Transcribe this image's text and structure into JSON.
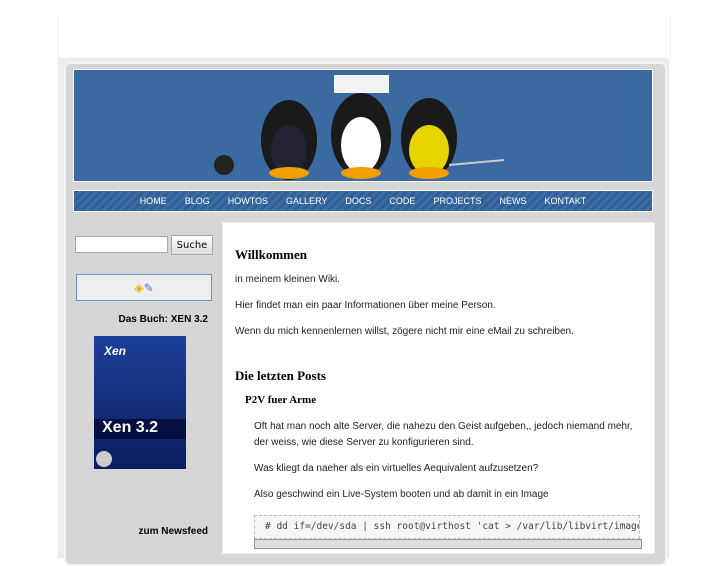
{
  "nav": [
    "HOME",
    "BLOG",
    "HOWTOS",
    "GALLERY",
    "DOCS",
    "CODE",
    "PROJECTS",
    "NEWS",
    "KONTAKT"
  ],
  "search": {
    "value": "",
    "button": "Suche"
  },
  "sidebar": {
    "book_title": "Das Buch: XEN 3.2",
    "book_cover_text": "Xen 3.2",
    "newsfeed": "zum Newsfeed"
  },
  "content": {
    "welcome_title": "Willkommen",
    "p1": "in meinem kleinen Wiki.",
    "p2": "Hier findet man ein paar Informationen über meine Person.",
    "p3": "Wenn du mich kennenlernen willst, zögere nicht mir eine eMail zu schreiben.",
    "posts_title": "Die letzten Posts",
    "post_title": "P2V fuer Arme",
    "post_p1a": "Oft hat man noch alte Server, die nahezu den Geist aufgeben,, jedoch niemand mehr,",
    "post_p1b": "der weiss, wie diese Server zu konfigurieren sind.",
    "post_p2": "Was kliegt da naeher als ein virtuelles Aequivalent aufzusetzen?",
    "post_p3": "Also geschwind ein Live-System booten und ab damit in ein Image",
    "code": "# dd if=/dev/sda | ssh root@virthost 'cat > /var/lib/libvirt/images"
  }
}
